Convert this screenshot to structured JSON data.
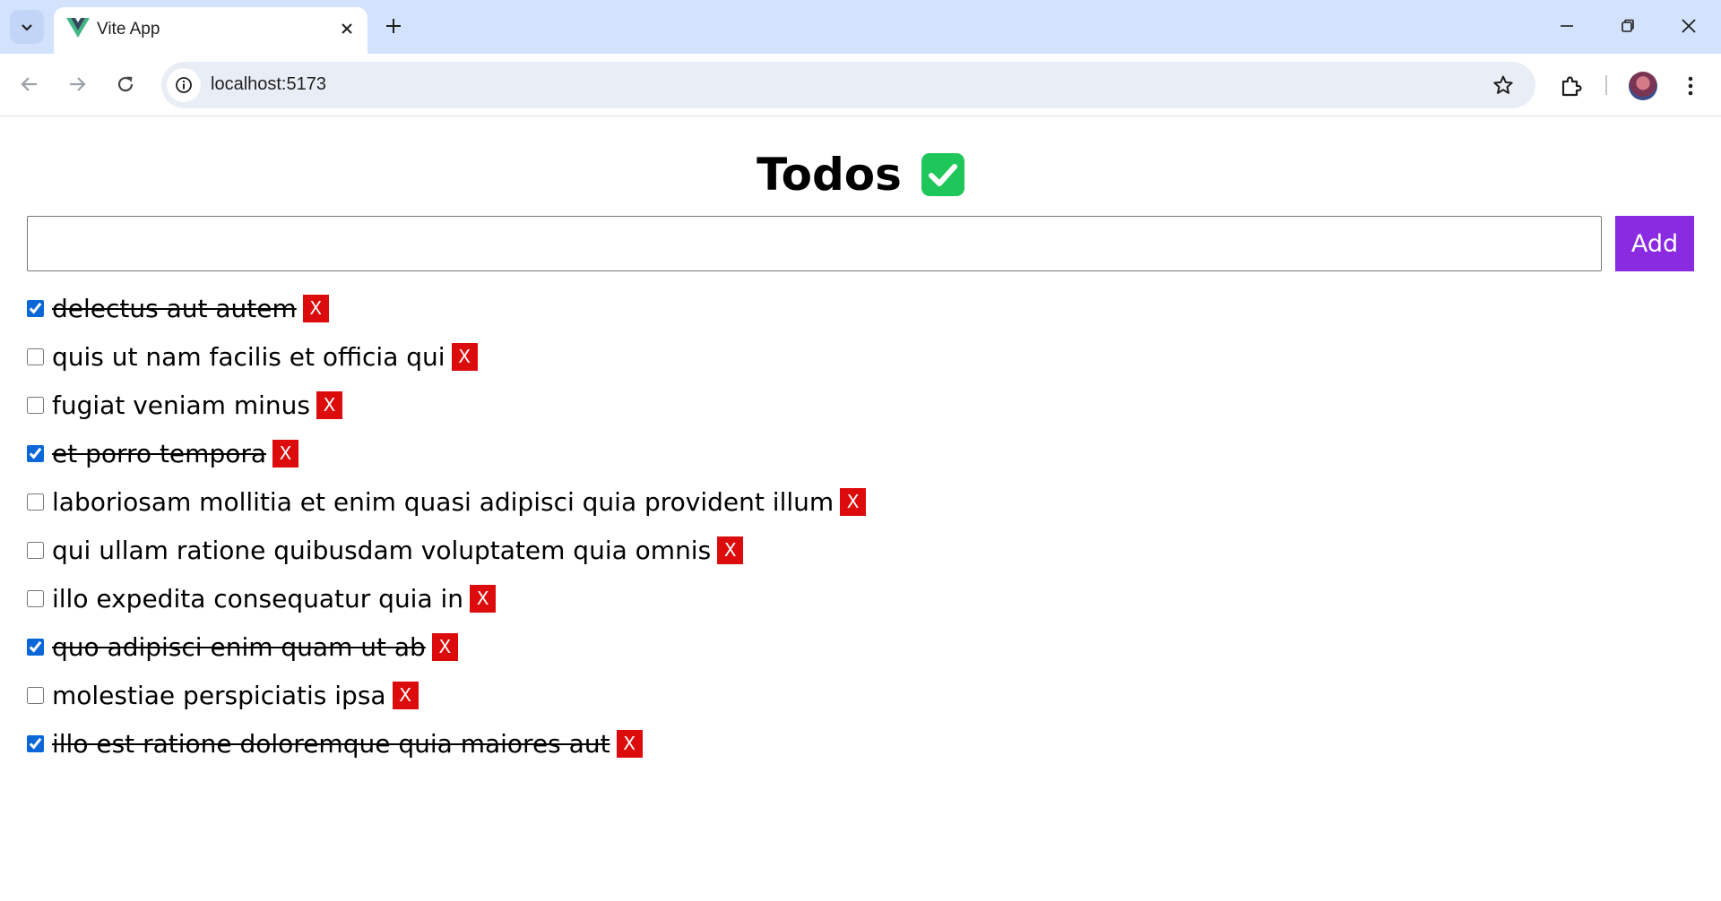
{
  "browser": {
    "tab_title": "Vite App",
    "url": "localhost:5173",
    "icons": {
      "tab_search": "chevron-down-icon",
      "favicon": "vue-logo-icon",
      "tab_close": "close-icon",
      "new_tab": "plus-icon",
      "back": "arrow-left-icon",
      "forward": "arrow-right-icon",
      "reload": "reload-icon",
      "site_info": "info-icon",
      "bookmark": "star-icon",
      "extensions": "puzzle-icon",
      "menu": "kebab-menu-icon"
    }
  },
  "app": {
    "title": "Todos",
    "title_emoji": "check-mark-button-icon",
    "input": {
      "value": "",
      "placeholder": ""
    },
    "add_label": "Add",
    "delete_label": "X",
    "colors": {
      "add_button": "#8a2be2",
      "delete_button": "#dc0c0c",
      "emoji_green": "#1fc65a"
    },
    "todos": [
      {
        "text": "delectus aut autem",
        "completed": true
      },
      {
        "text": "quis ut nam facilis et officia qui",
        "completed": false
      },
      {
        "text": "fugiat veniam minus",
        "completed": false
      },
      {
        "text": "et porro tempora",
        "completed": true
      },
      {
        "text": "laboriosam mollitia et enim quasi adipisci quia provident illum",
        "completed": false
      },
      {
        "text": "qui ullam ratione quibusdam voluptatem quia omnis",
        "completed": false
      },
      {
        "text": "illo expedita consequatur quia in",
        "completed": false
      },
      {
        "text": "quo adipisci enim quam ut ab",
        "completed": true
      },
      {
        "text": "molestiae perspiciatis ipsa",
        "completed": false
      },
      {
        "text": "illo est ratione doloremque quia maiores aut",
        "completed": true
      }
    ]
  }
}
